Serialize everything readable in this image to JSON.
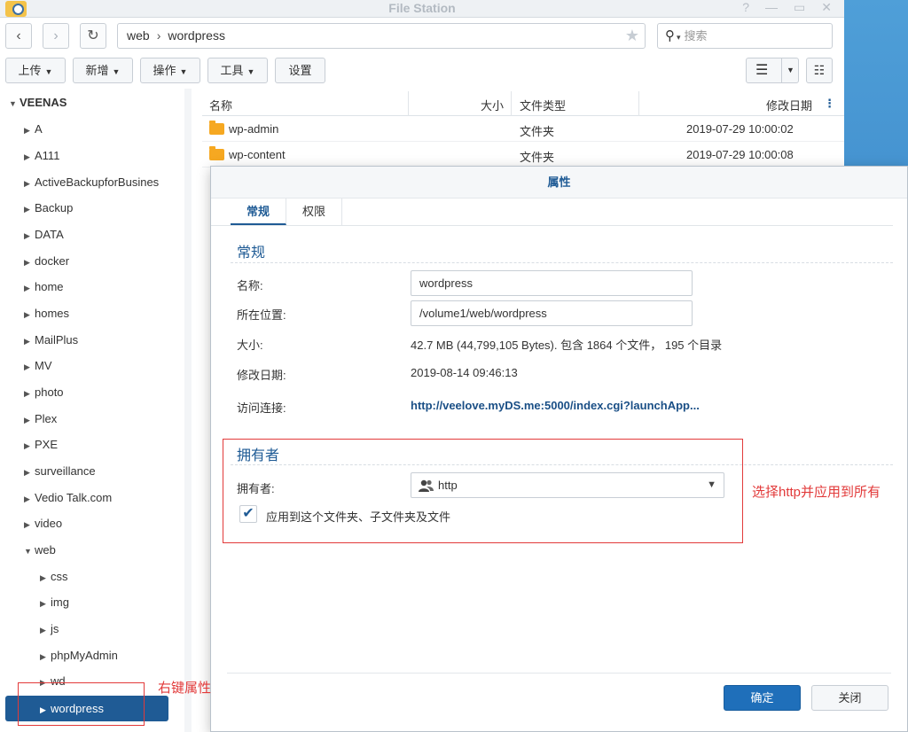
{
  "window": {
    "title": "File Station"
  },
  "nav": {
    "path": [
      "web",
      "wordpress"
    ],
    "search_placeholder": "搜索"
  },
  "toolbar": {
    "upload": "上传",
    "new": "新增",
    "action": "操作",
    "tools": "工具",
    "settings": "设置"
  },
  "sidebar": {
    "root": "VEENAS",
    "items": [
      "A",
      "A111",
      "ActiveBackupforBusines",
      "Backup",
      "DATA",
      "docker",
      "home",
      "homes",
      "MailPlus",
      "MV",
      "photo",
      "Plex",
      "PXE",
      "surveillance",
      "Vedio Talk.com",
      "video",
      "web"
    ],
    "web_children": [
      "css",
      "img",
      "js",
      "phpMyAdmin",
      "wd",
      "wordpress"
    ]
  },
  "file_list": {
    "columns": {
      "name": "名称",
      "size": "大小",
      "type": "文件类型",
      "modified": "修改日期"
    },
    "rows": [
      {
        "name": "wp-admin",
        "type": "文件夹",
        "modified": "2019-07-29 10:00:02"
      },
      {
        "name": "wp-content",
        "type": "文件夹",
        "modified": "2019-07-29 10:00:08"
      }
    ]
  },
  "dialog": {
    "title": "属性",
    "tabs": [
      "常规",
      "权限"
    ],
    "general": {
      "section": "常规",
      "name_label": "名称:",
      "name_value": "wordpress",
      "location_label": "所在位置:",
      "location_value": "/volume1/web/wordpress",
      "size_label": "大小:",
      "size_value": "42.7 MB (44,799,105 Bytes). 包含 1864 个文件， 195 个目录",
      "modified_label": "修改日期:",
      "modified_value": "2019-08-14 09:46:13",
      "link_label": "访问连接:",
      "link_value": "http://veelove.myDS.me:5000/index.cgi?launchApp..."
    },
    "owner": {
      "section": "拥有者",
      "owner_label": "拥有者:",
      "owner_value": "http",
      "apply_label": "应用到这个文件夹、子文件夹及文件",
      "apply_checked": true
    },
    "ok": "确定",
    "close": "关闭"
  },
  "annotations": {
    "right_click": "右键属性",
    "select_http": "选择http并应用到所有"
  }
}
